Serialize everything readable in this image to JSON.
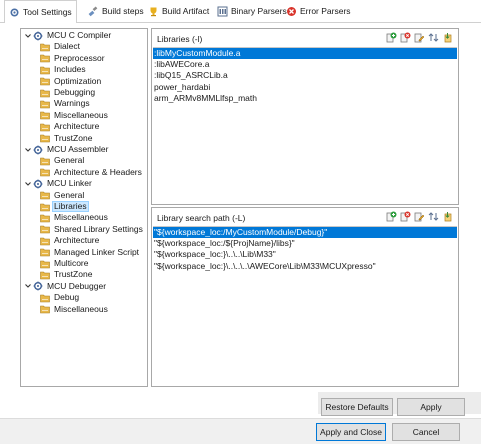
{
  "tabs": [
    {
      "label": "Tool Settings",
      "icon": "tool-settings-icon"
    },
    {
      "label": "Build steps",
      "icon": "build-steps-icon"
    },
    {
      "label": "Build Artifact",
      "icon": "build-artifact-icon"
    },
    {
      "label": "Binary Parsers",
      "icon": "binary-parsers-icon"
    },
    {
      "label": "Error Parsers",
      "icon": "error-parsers-icon"
    }
  ],
  "tree": [
    {
      "label": "MCU C Compiler",
      "level": 0,
      "expandable": true
    },
    {
      "label": "Dialect",
      "level": 1
    },
    {
      "label": "Preprocessor",
      "level": 1
    },
    {
      "label": "Includes",
      "level": 1
    },
    {
      "label": "Optimization",
      "level": 1
    },
    {
      "label": "Debugging",
      "level": 1
    },
    {
      "label": "Warnings",
      "level": 1
    },
    {
      "label": "Miscellaneous",
      "level": 1
    },
    {
      "label": "Architecture",
      "level": 1
    },
    {
      "label": "TrustZone",
      "level": 1
    },
    {
      "label": "MCU Assembler",
      "level": 0,
      "expandable": true
    },
    {
      "label": "General",
      "level": 1
    },
    {
      "label": "Architecture & Headers",
      "level": 1
    },
    {
      "label": "MCU Linker",
      "level": 0,
      "expandable": true
    },
    {
      "label": "General",
      "level": 1
    },
    {
      "label": "Libraries",
      "level": 1,
      "selected": true
    },
    {
      "label": "Miscellaneous",
      "level": 1
    },
    {
      "label": "Shared Library Settings",
      "level": 1
    },
    {
      "label": "Architecture",
      "level": 1
    },
    {
      "label": "Managed Linker Script",
      "level": 1
    },
    {
      "label": "Multicore",
      "level": 1
    },
    {
      "label": "TrustZone",
      "level": 1
    },
    {
      "label": "MCU Debugger",
      "level": 0,
      "expandable": true
    },
    {
      "label": "Debug",
      "level": 1
    },
    {
      "label": "Miscellaneous",
      "level": 1
    }
  ],
  "libraries": {
    "title": "Libraries (-l)",
    "items": [
      ":libMyCustomModule.a",
      ":libAWECore.a",
      ":libQ15_ASRCLib.a",
      "power_hardabi",
      "arm_ARMv8MMLlfsp_math"
    ],
    "selected_index": 0
  },
  "search_paths": {
    "title": "Library search path (-L)",
    "items": [
      "\"${workspace_loc:/MyCustomModule/Debug}\"",
      "\"${workspace_loc:/${ProjName}/libs}\"",
      "\"${workspace_loc:}\\..\\..\\Lib\\M33\"",
      "\"${workspace_loc:}\\..\\..\\..\\AWECore\\Lib\\M33\\MCUXpresso\""
    ],
    "selected_index": 0
  },
  "toolbar_icons": [
    "add-icon",
    "delete-icon",
    "edit-icon",
    "move-up-icon",
    "move-down-icon"
  ],
  "buttons": {
    "restore_defaults": "Restore Defaults",
    "apply": "Apply",
    "apply_and_close": "Apply and Close",
    "cancel": "Cancel"
  },
  "colors": {
    "selection": "#0078d7",
    "tree_selection": "#cce8ff",
    "folder": "#e8b84a",
    "error": "#d9342b"
  }
}
